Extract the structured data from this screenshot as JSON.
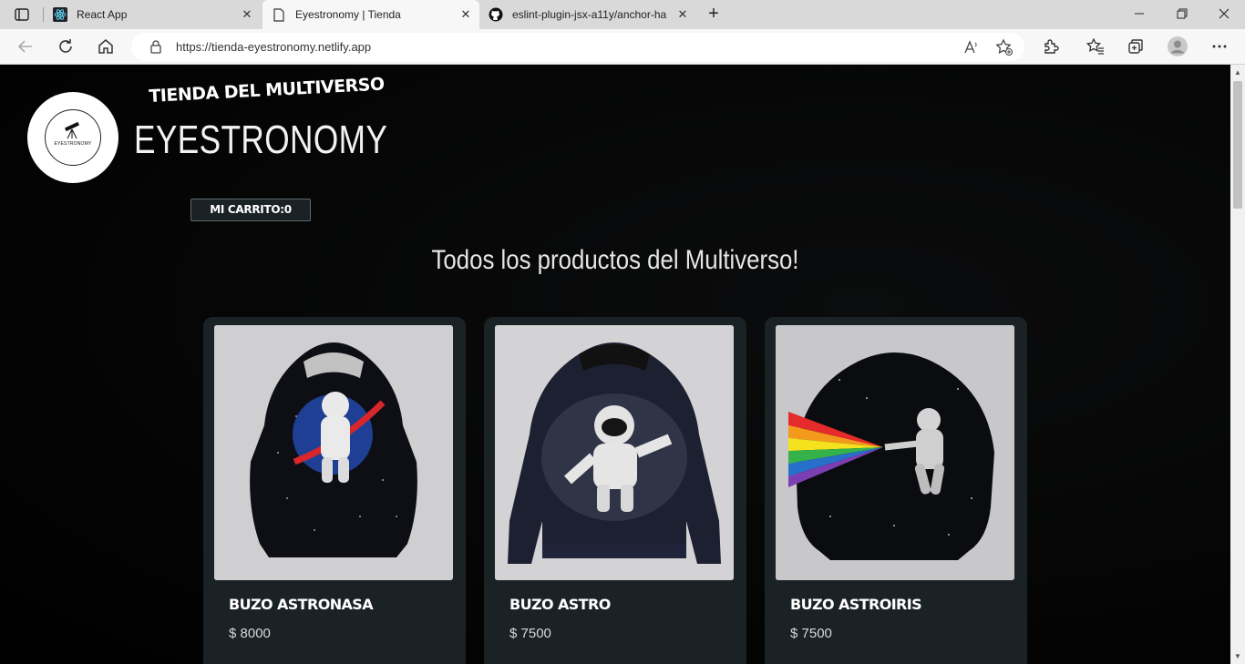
{
  "browser": {
    "tabs": [
      {
        "title": "React App",
        "active": false
      },
      {
        "title": "Eyestronomy | Tienda",
        "active": true
      },
      {
        "title": "eslint-plugin-jsx-a11y/anchor-ha",
        "active": false
      }
    ],
    "url": "https://tienda-eyestronomy.netlify.app"
  },
  "header": {
    "tagline": "TIENDA DEL MULTIVERSO",
    "brand": "EYESTRONOMY",
    "logo_text": "EYESTRONOMY",
    "cart_label": "MI CARRITO:0"
  },
  "main": {
    "headline": "Todos los productos del Multiverso!",
    "products": [
      {
        "name": "BUZO ASTRONASA",
        "price": "$ 8000"
      },
      {
        "name": "BUZO ASTRO",
        "price": "$ 7500"
      },
      {
        "name": "BUZO ASTROIRIS",
        "price": "$ 7500"
      }
    ]
  },
  "colors": {
    "page_bg": "#000000",
    "card_bg": "#1a2226",
    "text": "#ffffff"
  }
}
